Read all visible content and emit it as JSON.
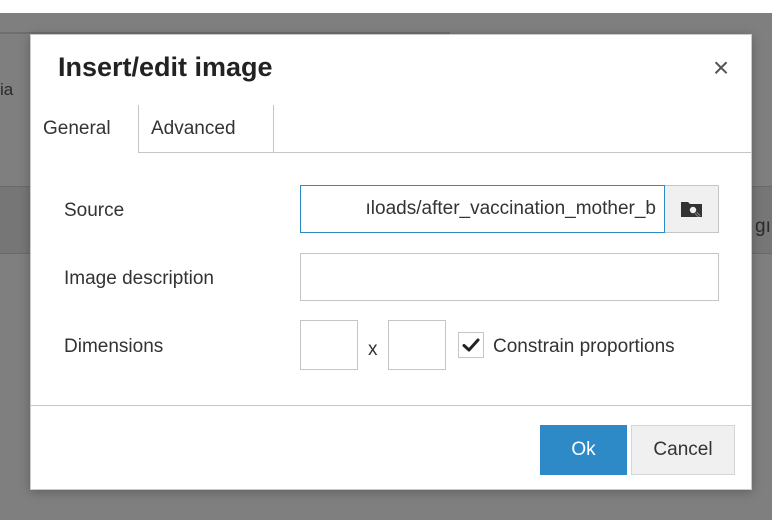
{
  "background": {
    "left_text": "ia",
    "right_text": "gı"
  },
  "dialog": {
    "title": "Insert/edit image",
    "close_glyph": "×",
    "tabs": [
      {
        "label": "General",
        "active": true
      },
      {
        "label": "Advanced",
        "active": false
      }
    ],
    "fields": {
      "source_label": "Source",
      "source_value": "ıloads/after_vaccination_mother_b",
      "browse_icon": "folder-search-icon",
      "description_label": "Image description",
      "description_value": "",
      "dimensions_label": "Dimensions",
      "width_value": "",
      "height_value": "",
      "x_separator": "x",
      "constrain_label": "Constrain proportions",
      "constrain_checked": true
    },
    "buttons": {
      "ok": "Ok",
      "cancel": "Cancel"
    }
  },
  "colors": {
    "accent": "#2d8ac7",
    "overlay": "#7f7f7f"
  }
}
